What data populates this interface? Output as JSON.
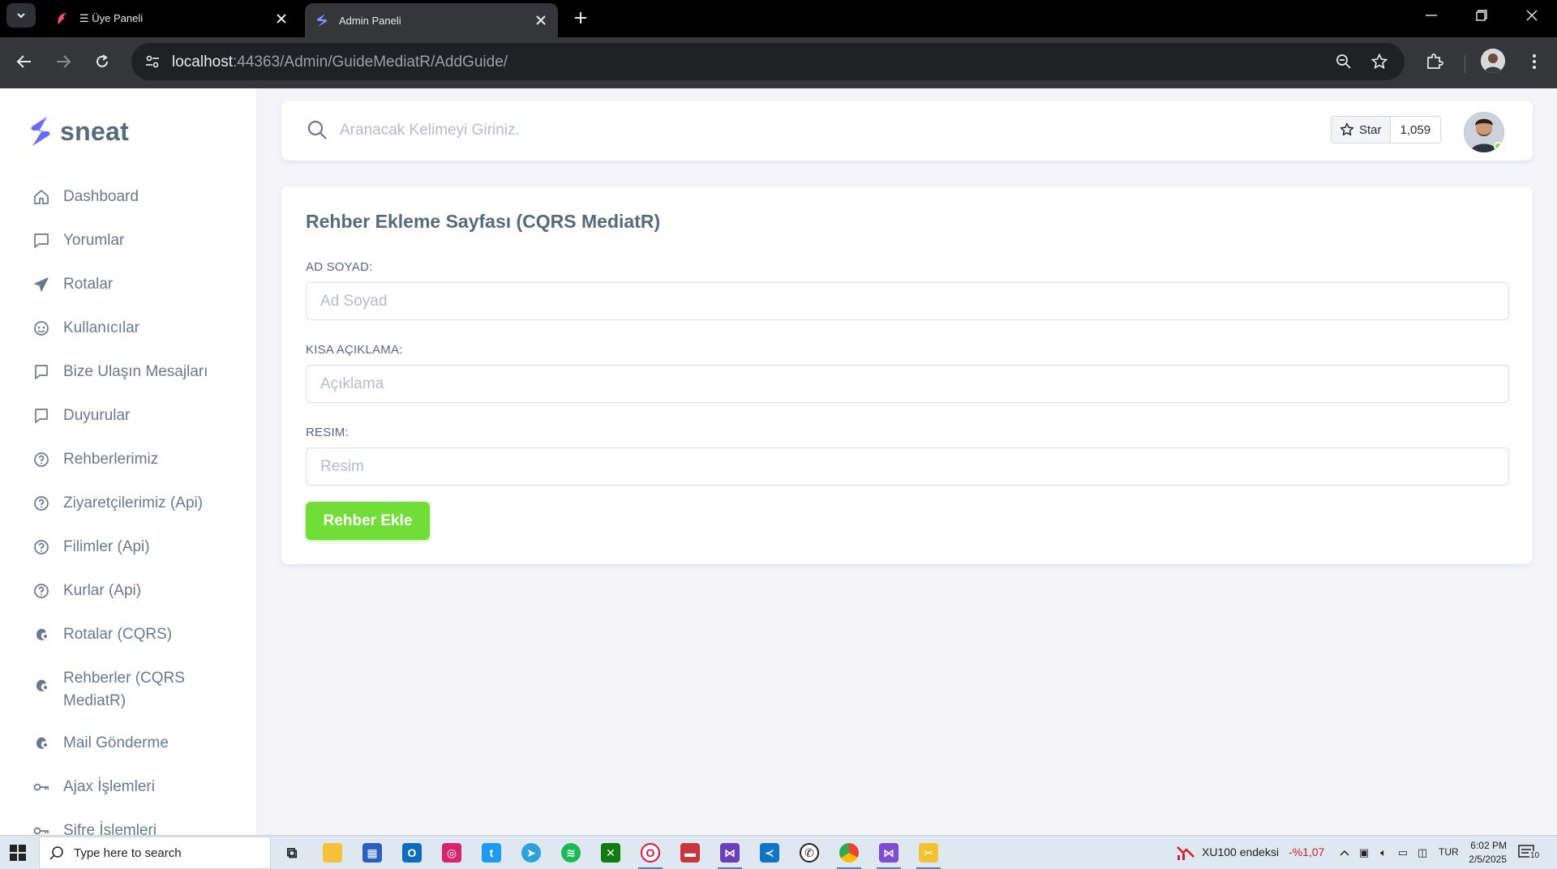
{
  "browser": {
    "tabs": [
      {
        "title": "☰ Üye Paneli",
        "active": false
      },
      {
        "title": "Admin Paneli",
        "active": true
      }
    ],
    "url_host": "localhost",
    "url_path": ":44363/Admin/GuideMediatR/AddGuide/"
  },
  "brand": {
    "name": "sneat",
    "accent": "#696cff"
  },
  "sidebar": {
    "items": [
      {
        "label": "Dashboard",
        "icon": "home-icon"
      },
      {
        "label": "Yorumlar",
        "icon": "comment-icon"
      },
      {
        "label": "Rotalar",
        "icon": "plane-icon"
      },
      {
        "label": "Kullanıcılar",
        "icon": "user-face-icon"
      },
      {
        "label": "Bize Ulaşın Mesajları",
        "icon": "message-icon"
      },
      {
        "label": "Duyurular",
        "icon": "message-icon"
      },
      {
        "label": "Rehberlerimiz",
        "icon": "help-circle-icon"
      },
      {
        "label": "Ziyaretçilerimiz (Api)",
        "icon": "help-circle-icon"
      },
      {
        "label": "Filimler (Api)",
        "icon": "help-circle-icon"
      },
      {
        "label": "Kurlar (Api)",
        "icon": "help-circle-icon"
      },
      {
        "label": "Rotalar (CQRS)",
        "icon": "mailchimp-icon"
      },
      {
        "label": "Rehberler (CQRS MediatR)",
        "icon": "mailchimp-icon"
      },
      {
        "label": "Mail Gönderme",
        "icon": "mailchimp-icon"
      },
      {
        "label": "Ajax İşlemleri",
        "icon": "key-icon"
      },
      {
        "label": "Şifre İşlemleri",
        "icon": "key-icon"
      }
    ]
  },
  "topbar": {
    "search_placeholder": "Aranacak Kelimeyi Giriniz.",
    "github_star_label": "Star",
    "github_star_count": "1,059"
  },
  "form": {
    "title": "Rehber Ekleme Sayfası (CQRS MediatR)",
    "fields": [
      {
        "label": "AD SOYAD:",
        "placeholder": "Ad Soyad"
      },
      {
        "label": "KISA AÇIKLAMA:",
        "placeholder": "Açıklama"
      },
      {
        "label": "RESIM:",
        "placeholder": "Resim"
      }
    ],
    "submit_label": "Rehber Ekle",
    "submit_color": "#71dd37"
  },
  "taskbar": {
    "search_text": "Type here to search",
    "ticker_name": "XU100 endeksi",
    "ticker_change": "-%1,07",
    "language": "TUR",
    "time": "6:02 PM",
    "date": "2/5/2025",
    "notification_count": "10"
  }
}
